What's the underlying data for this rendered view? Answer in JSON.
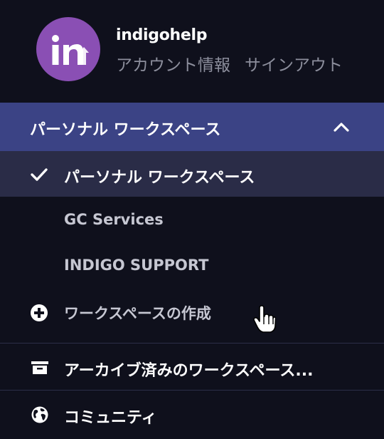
{
  "account": {
    "username": "indigohelp",
    "account_info_link": "アカウント情報",
    "sign_out_link": "サインアウト",
    "avatar_text": "IN"
  },
  "workspace_menu": {
    "header_label": "パーソナル ワークスペース",
    "selected_item": "パーソナル ワークスペース",
    "items": [
      {
        "label": "GC Services"
      },
      {
        "label": "INDIGO SUPPORT"
      }
    ],
    "create_label": "ワークスペースの作成"
  },
  "footer": {
    "archived_label": "アーカイブ済みのワークスペース...",
    "community_label": "コミュニティ"
  },
  "colors": {
    "background": "#0f101c",
    "header_band": "#3b4385",
    "selected_row": "#2a2c47",
    "avatar": "#8a4fb4"
  }
}
